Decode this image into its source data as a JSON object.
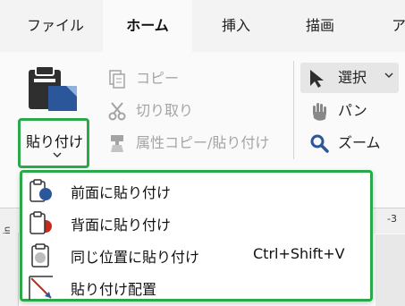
{
  "tabs": [
    {
      "label": "ファイル",
      "active": false
    },
    {
      "label": "ホーム",
      "active": true
    },
    {
      "label": "挿入",
      "active": false
    },
    {
      "label": "描画",
      "active": false
    },
    {
      "label": "ア",
      "active": false
    }
  ],
  "clipboard": {
    "paste_label": "貼り付け",
    "copy_label": "コピー",
    "cut_label": "切り取り",
    "format_painter_label": "属性コピー/貼り付け"
  },
  "tools": {
    "select_label": "選択",
    "pan_label": "パン",
    "zoom_label": "ズーム"
  },
  "paste_menu": {
    "items": [
      {
        "label": "前面に貼り付け",
        "shortcut": ""
      },
      {
        "label": "背面に貼り付け",
        "shortcut": ""
      },
      {
        "label": "同じ位置に貼り付け",
        "shortcut": "Ctrl+Shift+V"
      },
      {
        "label": "貼り付け配置",
        "shortcut": ""
      }
    ]
  },
  "ruler": {
    "unit": "in",
    "number": "-3"
  },
  "colors": {
    "highlight_border": "#2ba84a",
    "paste_icon_blue": "#2b579a",
    "front_dot": "#2b579a",
    "back_dot": "#c42b1c"
  }
}
